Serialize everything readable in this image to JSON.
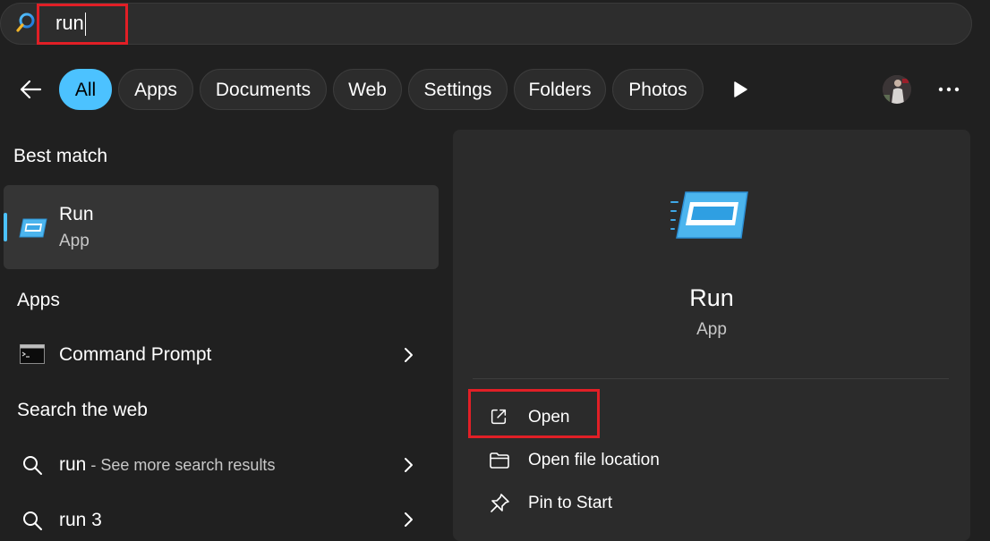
{
  "search": {
    "query": "run"
  },
  "filters": {
    "chips": [
      {
        "label": "All",
        "active": true
      },
      {
        "label": "Apps"
      },
      {
        "label": "Documents"
      },
      {
        "label": "Web"
      },
      {
        "label": "Settings"
      },
      {
        "label": "Folders"
      },
      {
        "label": "Photos"
      }
    ]
  },
  "left": {
    "best_match": {
      "heading": "Best match",
      "title": "Run",
      "subtitle": "App"
    },
    "apps": {
      "heading": "Apps",
      "items": [
        {
          "label": "Command Prompt"
        }
      ]
    },
    "web": {
      "heading": "Search the web",
      "items": [
        {
          "query": "run",
          "suffix": " - See more search results"
        },
        {
          "query": "run 3",
          "suffix": ""
        }
      ]
    }
  },
  "right": {
    "app_name": "Run",
    "app_type": "App",
    "actions": [
      {
        "label": "Open",
        "icon": "open-external-icon"
      },
      {
        "label": "Open file location",
        "icon": "folder-icon"
      },
      {
        "label": "Pin to Start",
        "icon": "pin-icon"
      }
    ]
  },
  "colors": {
    "background": "#202020",
    "accent": "#4cc2ff",
    "highlight": "#e11f26",
    "panel": "#2b2b2b"
  }
}
